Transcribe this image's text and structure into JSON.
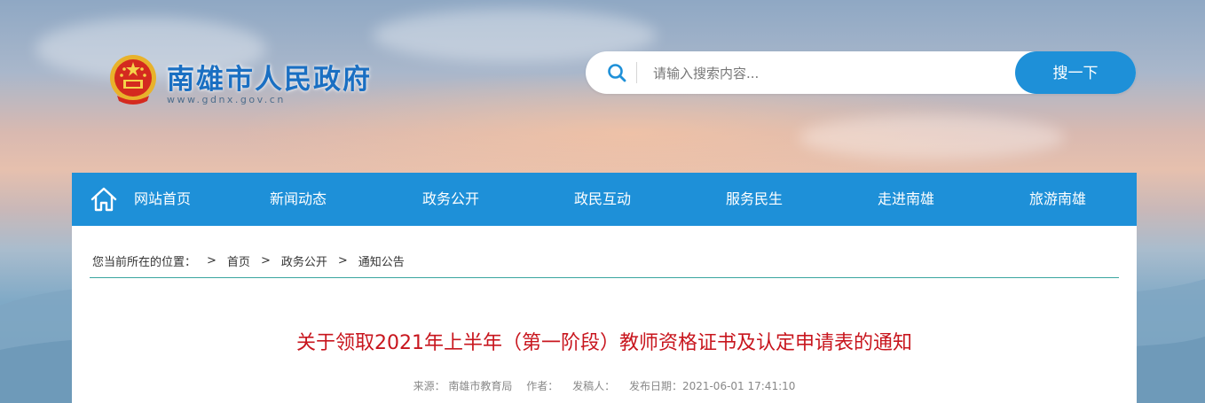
{
  "header": {
    "site_title": "南雄市人民政府",
    "site_domain": "www.gdnx.gov.cn"
  },
  "search": {
    "placeholder": "请输入搜索内容...",
    "value": "",
    "button_label": "搜一下"
  },
  "nav": {
    "items": [
      {
        "label": "网站首页"
      },
      {
        "label": "新闻动态"
      },
      {
        "label": "政务公开"
      },
      {
        "label": "政民互动"
      },
      {
        "label": "服务民生"
      },
      {
        "label": "走进南雄"
      },
      {
        "label": "旅游南雄"
      }
    ]
  },
  "breadcrumb": {
    "prefix": "您当前所在的位置：",
    "separator": ">",
    "items": [
      "首页",
      "政务公开",
      "通知公告"
    ]
  },
  "article": {
    "title": "关于领取2021年上半年（第一阶段）教师资格证书及认定申请表的通知",
    "meta": {
      "source": "来源： 南雄市教育局",
      "author": "作者：",
      "submitter": "发稿人：",
      "date": "发布日期：2021-06-01 17:41:10"
    }
  },
  "colors": {
    "primary": "#1e90d8",
    "title_red": "#c8161e",
    "accent_line": "#3aa6a0"
  },
  "icons": {
    "emblem": "national-emblem-icon",
    "search": "search-icon",
    "home": "home-icon"
  }
}
